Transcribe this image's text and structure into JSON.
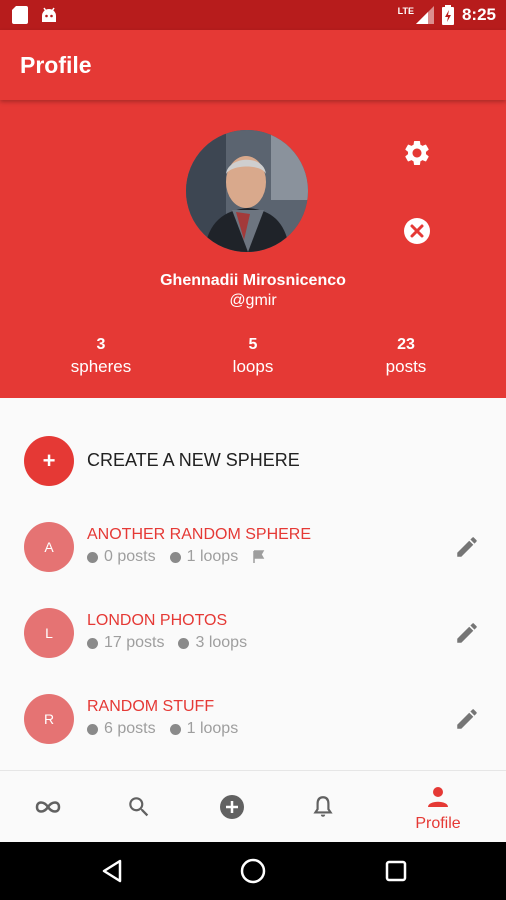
{
  "status_bar": {
    "time": "8:25",
    "network": "LTE"
  },
  "toolbar": {
    "title": "Profile"
  },
  "profile": {
    "name": "Ghennadii Mirosnicenco",
    "handle": "@gmir",
    "stats": [
      {
        "count": "3",
        "label": "spheres"
      },
      {
        "count": "5",
        "label": "loops"
      },
      {
        "count": "23",
        "label": "posts"
      }
    ]
  },
  "create_sphere": {
    "icon": "+",
    "label": "CREATE A NEW SPHERE"
  },
  "spheres": [
    {
      "initial": "A",
      "name": "ANOTHER RANDOM SPHERE",
      "posts": "0 posts",
      "loops": "1 loops",
      "flag": true
    },
    {
      "initial": "L",
      "name": "LONDON PHOTOS",
      "posts": "17 posts",
      "loops": "3 loops",
      "flag": false
    },
    {
      "initial": "R",
      "name": "RANDOM STUFF",
      "posts": "6 posts",
      "loops": "1 loops",
      "flag": false
    }
  ],
  "bottom_nav": {
    "items": [
      "loops-icon",
      "search-icon",
      "add-circle-icon",
      "bell-icon",
      "person-icon"
    ],
    "active_label": "Profile"
  },
  "colors": {
    "primary": "#e53935",
    "primary_dark": "#b71c1c",
    "sphere_avatar": "#e57373"
  }
}
